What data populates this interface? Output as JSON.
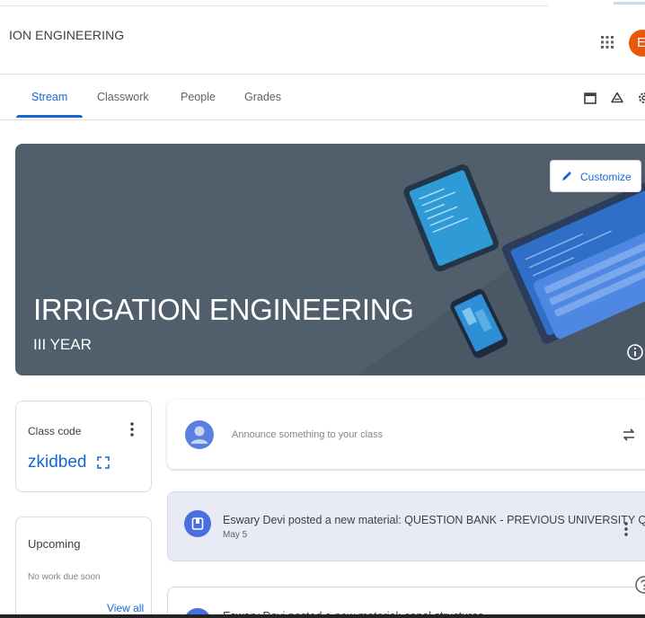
{
  "header": {
    "class_title": "ION ENGINEERING",
    "avatar_letter": "E",
    "avatar_color": "#e8590c"
  },
  "tabs": [
    {
      "label": "Stream",
      "active": true
    },
    {
      "label": "Classwork",
      "active": false
    },
    {
      "label": "People",
      "active": false
    },
    {
      "label": "Grades",
      "active": false
    }
  ],
  "toolbar_icons": [
    "calendar-icon",
    "drive-icon",
    "settings-icon"
  ],
  "banner": {
    "title": "IRRIGATION ENGINEERING",
    "subtitle": "III YEAR",
    "customize_label": "Customize",
    "background": "#505f6b"
  },
  "class_code": {
    "label": "Class code",
    "code": "zkidbed"
  },
  "upcoming": {
    "title": "Upcoming",
    "empty_text": "No work due soon",
    "view_all": "View all"
  },
  "announce": {
    "placeholder": "Announce something to your class"
  },
  "posts": [
    {
      "text": "Eswary Devi posted a new material: QUESTION BANK - PREVIOUS UNIVERSITY Q...",
      "date": "May 5"
    },
    {
      "text": "Eswary Devi posted a new material: canal structures",
      "date": ""
    }
  ],
  "colors": {
    "accent": "#1967d2",
    "post_background": "#e8eaf6"
  }
}
